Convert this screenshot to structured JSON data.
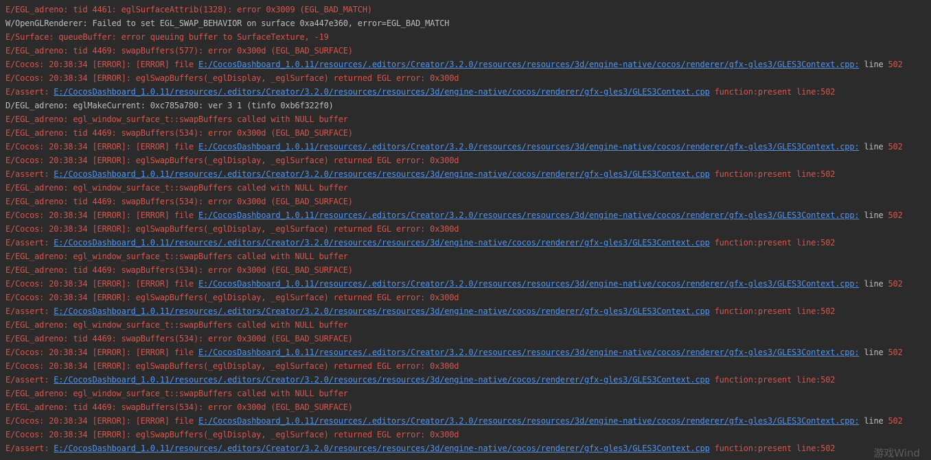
{
  "console": {
    "colors": {
      "background": "#2B2B2B",
      "error": "#D7554E",
      "normal": "#BCBEBF",
      "link": "#5394EC"
    },
    "line_defs": {
      "egl_surface_attrib": [
        {
          "text": "E/EGL_adreno: tid 4461: eglSurfaceAttrib(1328): error 0x3009 (EGL_BAD_MATCH)",
          "style": "error"
        }
      ],
      "opengl_renderer": [
        {
          "text": "W/OpenGLRenderer: Failed to set EGL_SWAP_BEHAVIOR on surface 0xa447e360, error=EGL_BAD_MATCH",
          "style": "normal"
        }
      ],
      "surface_queue_buffer": [
        {
          "text": "E/Surface: queueBuffer: error queuing buffer to SurfaceTexture, -19",
          "style": "error"
        }
      ],
      "swap_buffers_577": [
        {
          "text": "E/EGL_adreno: tid 4469: swapBuffers(577): error 0x300d (EGL_BAD_SURFACE)",
          "style": "error"
        }
      ],
      "cocos_error_file": [
        {
          "text": "E/Cocos: 20:38:34 [ERROR]: [ERROR] file ",
          "style": "error"
        },
        {
          "text": "E:/CocosDashboard_1.0.11/resources/.editors/Creator/3.2.0/resources/resources/3d/engine-native/cocos/renderer/gfx-gles3/GLES3Context.cpp:",
          "style": "link"
        },
        {
          "text": " line ",
          "style": "normal"
        },
        {
          "text": "502",
          "style": "error"
        }
      ],
      "cocos_egl_swap": [
        {
          "text": "E/Cocos: 20:38:34 [ERROR]: eglSwapBuffers(_eglDisplay, _eglSurface) returned EGL error: 0x300d",
          "style": "error"
        }
      ],
      "assert_present": [
        {
          "text": "E/assert: ",
          "style": "error"
        },
        {
          "text": "E:/CocosDashboard_1.0.11/resources/.editors/Creator/3.2.0/resources/resources/3d/engine-native/cocos/renderer/gfx-gles3/GLES3Context.cpp",
          "style": "link"
        },
        {
          "text": " function:present line:502",
          "style": "error"
        }
      ],
      "egl_make_current": [
        {
          "text": "D/EGL_adreno: eglMakeCurrent: 0xc785a780: ver 3 1 (tinfo 0xb6f322f0)",
          "style": "normal"
        }
      ],
      "null_buffer": [
        {
          "text": "E/EGL_adreno: egl_window_surface_t::swapBuffers called with NULL buffer",
          "style": "error"
        }
      ],
      "swap_buffers_534": [
        {
          "text": "E/EGL_adreno: tid 4469: swapBuffers(534): error 0x300d (EGL_BAD_SURFACE)",
          "style": "error"
        }
      ]
    },
    "sequence": [
      "egl_surface_attrib",
      "opengl_renderer",
      "surface_queue_buffer",
      "swap_buffers_577",
      "cocos_error_file",
      "cocos_egl_swap",
      "assert_present",
      "egl_make_current",
      "null_buffer",
      "swap_buffers_534",
      "cocos_error_file",
      "cocos_egl_swap",
      "assert_present",
      "null_buffer",
      "swap_buffers_534",
      "cocos_error_file",
      "cocos_egl_swap",
      "assert_present",
      "null_buffer",
      "swap_buffers_534",
      "cocos_error_file",
      "cocos_egl_swap",
      "assert_present",
      "null_buffer",
      "swap_buffers_534",
      "cocos_error_file",
      "cocos_egl_swap",
      "assert_present",
      "null_buffer",
      "swap_buffers_534",
      "cocos_error_file",
      "cocos_egl_swap",
      "assert_present"
    ]
  },
  "watermark": {
    "text": "游戏Wind"
  }
}
